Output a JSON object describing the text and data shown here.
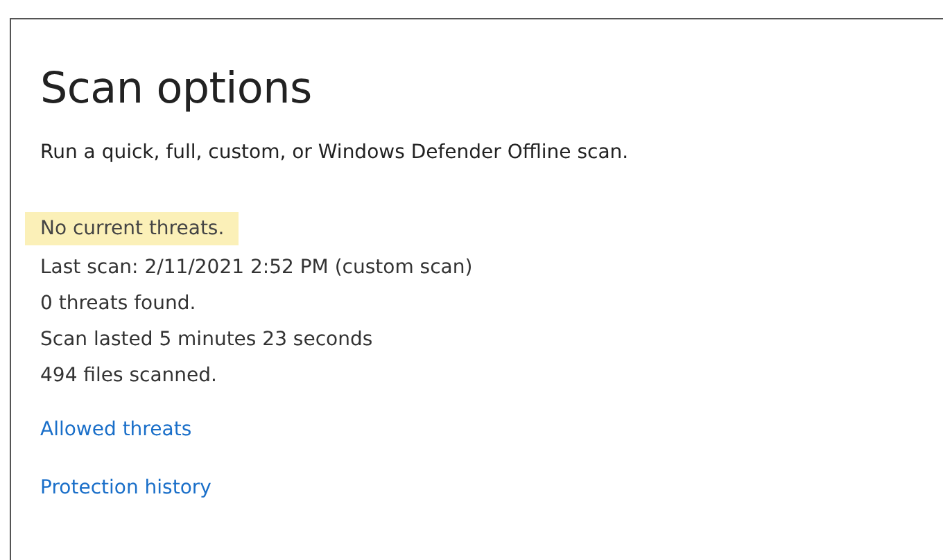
{
  "title": "Scan options",
  "description": "Run a quick, full, custom, or Windows Defender Offline scan.",
  "status": "No current threats.",
  "details": [
    "Last scan: 2/11/2021 2:52 PM (custom scan)",
    "0 threats found.",
    "Scan lasted 5 minutes 23 seconds",
    "494 files scanned."
  ],
  "links": [
    "Allowed threats",
    "Protection history"
  ]
}
